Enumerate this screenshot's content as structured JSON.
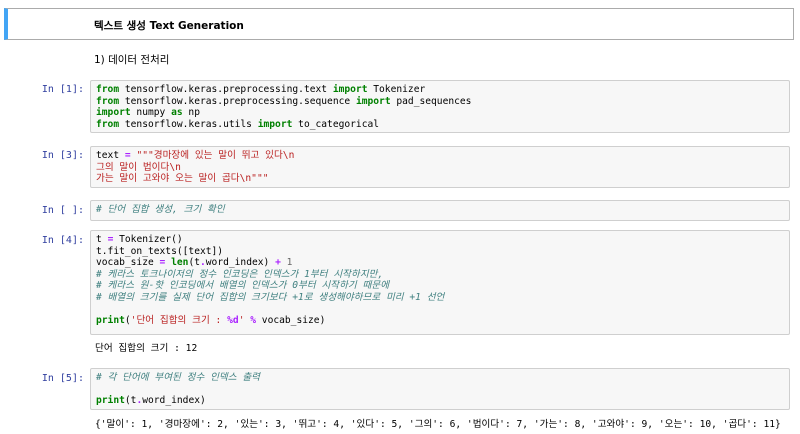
{
  "markdown": {
    "title": "텍스트 생성 Text Generation",
    "subtitle": "1) 데이터 전처리"
  },
  "cells": {
    "c1": {
      "prompt": "In [1]:",
      "line1": {
        "a": "from",
        "b": " tensorflow.keras.preprocessing.text ",
        "c": "import",
        "d": " Tokenizer"
      },
      "line2": {
        "a": "from",
        "b": " tensorflow.keras.preprocessing.sequence ",
        "c": "import",
        "d": " pad_sequences"
      },
      "line3": {
        "a": "import",
        "b": " numpy ",
        "c": "as",
        "d": " np"
      },
      "line4": {
        "a": "from",
        "b": " tensorflow.keras.utils ",
        "c": "import",
        "d": " to_categorical"
      }
    },
    "c2": {
      "prompt": "In [3]:",
      "line1": {
        "a": "text ",
        "b": "=",
        "c": " \"\"\"경마장에 있는 말이 뛰고 있다\\n"
      },
      "line2": "그의 말이 법이다\\n",
      "line3": "가는 말이 고와야 오는 말이 곱다\\n\"\"\""
    },
    "c3": {
      "prompt": "In [ ]:",
      "line1": "# 단어 집합 생성, 크기 확인"
    },
    "c4": {
      "prompt": "In [4]:",
      "line1": {
        "a": "t ",
        "b": "=",
        "c": " Tokenizer()"
      },
      "line2": "t.fit_on_texts([text])",
      "line3": {
        "a": "vocab_size ",
        "b": "=",
        "c": " len",
        "d": "(t",
        "e": ".",
        "f": "word_index) ",
        "g": "+",
        "h": " ",
        "i": "1"
      },
      "line4": "# 케라스 토크나이저의 정수 인코딩은 인덱스가 1부터 시작하지만,",
      "line5": "# 케라스 원-핫 인코딩에서 배열의 인덱스가 0부터 시작하기 때문에",
      "line6": "# 배열의 크기를 실제 단어 집합의 크기보다 +1로 생성해야하므로 미리 +1 선언",
      "line8": {
        "a": "print",
        "b": "(",
        "c": "'단어 집합의 크기 : ",
        "d": "%d",
        "e": "' ",
        "f": "%",
        "g": " vocab_size)"
      },
      "output": "단어 집합의 크기 : 12"
    },
    "c5": {
      "prompt": "In [5]:",
      "line1": "# 각 단어에 부여된 정수 인덱스 출력",
      "line3": {
        "a": "print",
        "b": "(t",
        "c": ".",
        "d": "word_index)"
      },
      "output": "{'말이': 1, '경마장에': 2, '있는': 3, '뛰고': 4, '있다': 5, '그의': 6, '법이다': 7, '가는': 8, '고와야': 9, '오는': 10, '곱다': 11}"
    }
  },
  "colors": {
    "prompt": "#303f9f",
    "keyword": "#008000",
    "string": "#ba2121",
    "comment": "#408080",
    "operator": "#aa22ff",
    "selection_bar": "#42a5f5"
  }
}
